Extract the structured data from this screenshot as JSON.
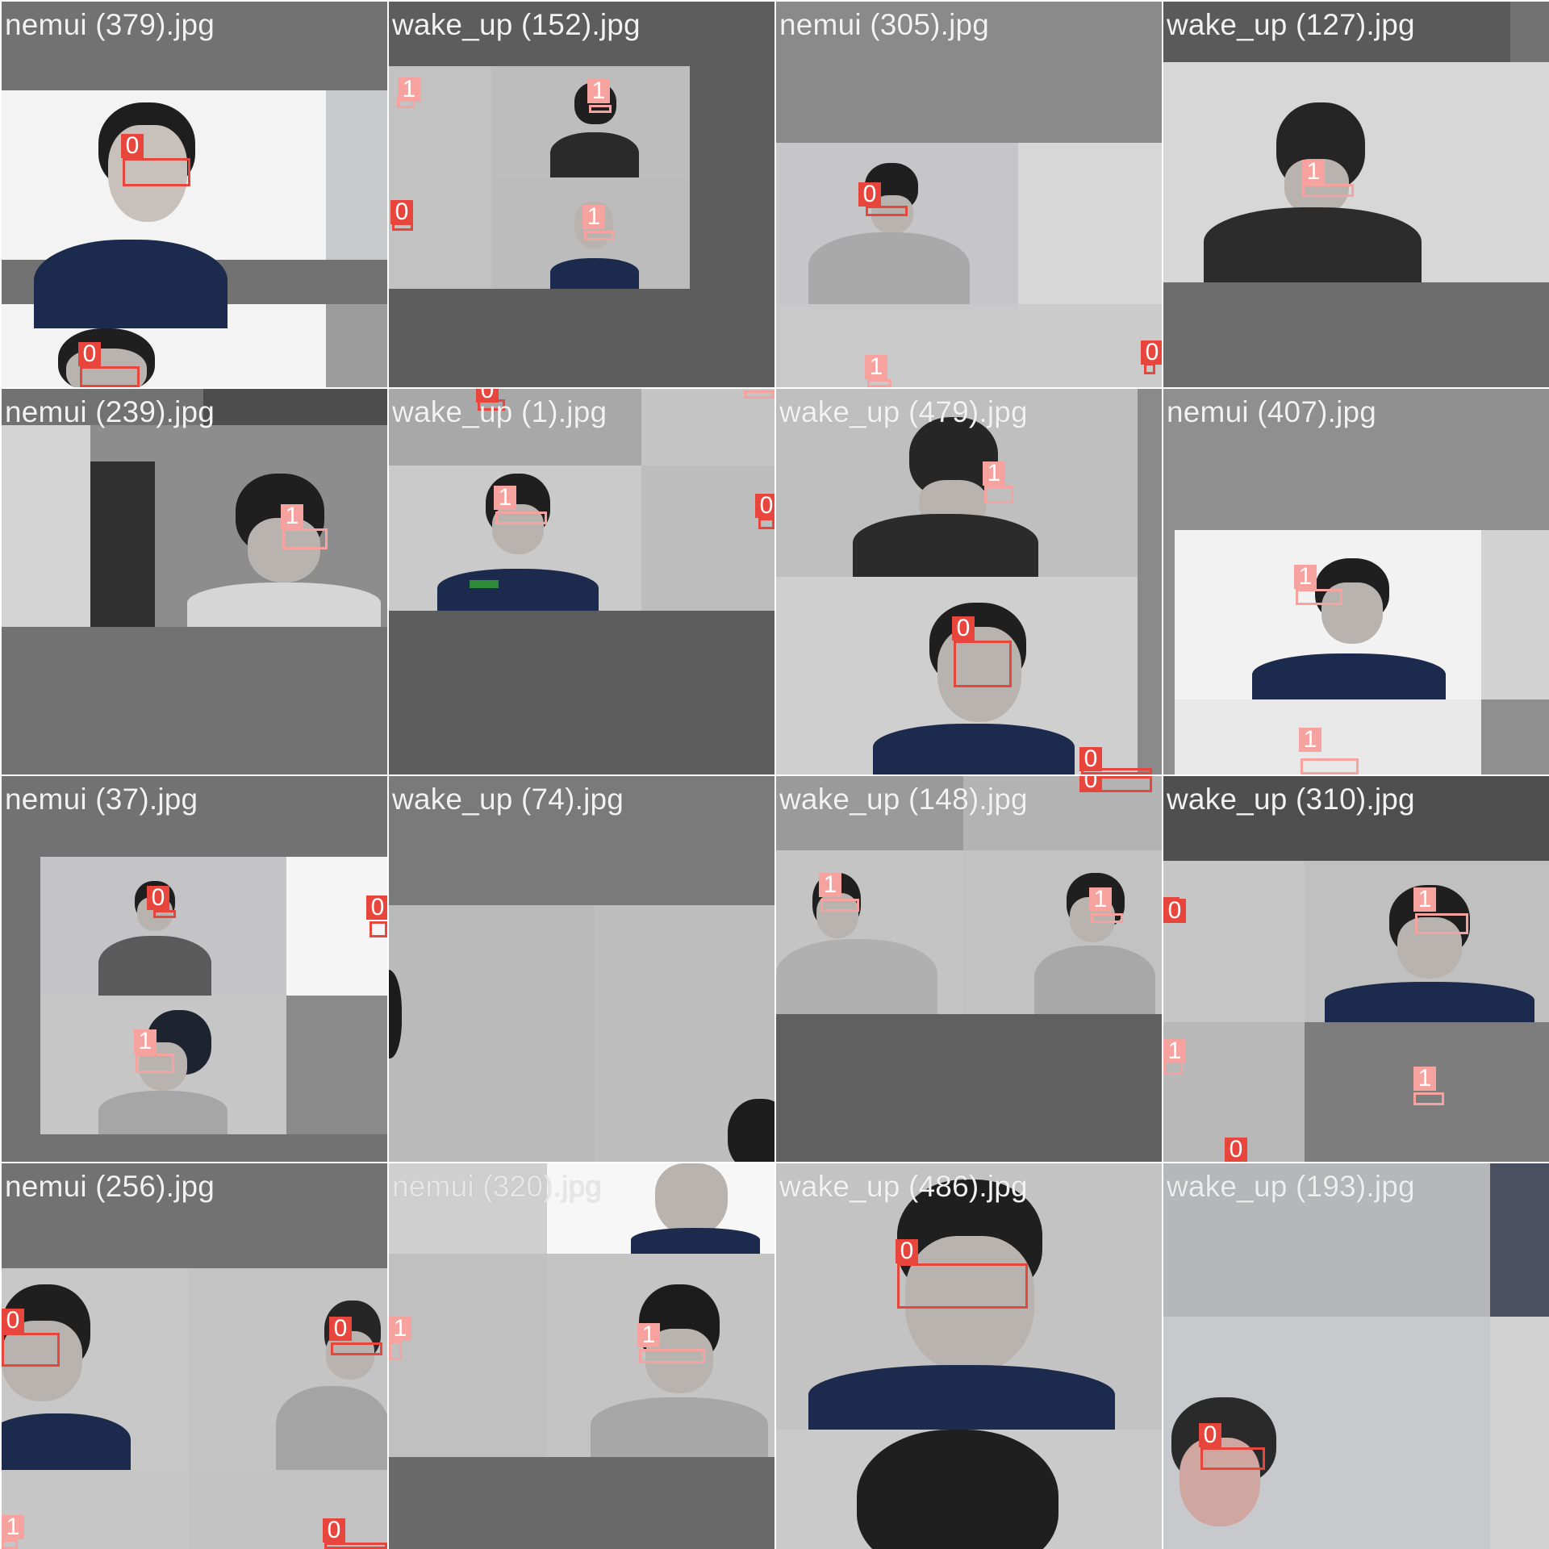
{
  "tiles": [
    {
      "caption": "nemui (379).jpg"
    },
    {
      "caption": "wake_up (152).jpg"
    },
    {
      "caption": "nemui (305).jpg"
    },
    {
      "caption": "wake_up (127).jpg"
    },
    {
      "caption": "nemui (239).jpg"
    },
    {
      "caption": "wake_up (1).jpg"
    },
    {
      "caption": "wake_up (479).jpg"
    },
    {
      "caption": "nemui (407).jpg"
    },
    {
      "caption": "nemui (37).jpg"
    },
    {
      "caption": "wake_up (74).jpg"
    },
    {
      "caption": "wake_up (148).jpg"
    },
    {
      "caption": "wake_up (310).jpg"
    },
    {
      "caption": "nemui (256).jpg"
    },
    {
      "caption": "nemui (320).jpg"
    },
    {
      "caption": "wake_up (486).jpg"
    },
    {
      "caption": "wake_up (193).jpg"
    }
  ],
  "classes": {
    "0": "0",
    "1": "1"
  },
  "colors": {
    "class_0": "#e8453c",
    "class_1": "#f6a3a0",
    "padding": "#727272"
  }
}
